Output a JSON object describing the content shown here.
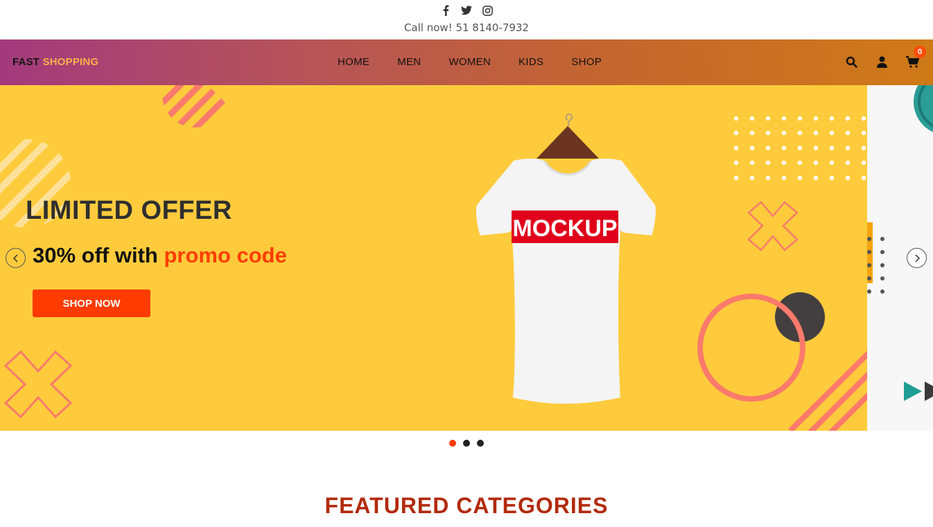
{
  "topbar": {
    "social": [
      {
        "name": "facebook-icon"
      },
      {
        "name": "twitter-icon"
      },
      {
        "name": "instagram-icon"
      }
    ],
    "phone_text": "Call now! 51 8140-7932"
  },
  "nav": {
    "logo_part1": "FAST",
    "logo_part2": "SHOPPING",
    "items": [
      {
        "label": "HOME"
      },
      {
        "label": "MEN"
      },
      {
        "label": "WOMEN"
      },
      {
        "label": "KIDS"
      },
      {
        "label": "SHOP"
      }
    ],
    "cart_count": "0",
    "icons": [
      "search-icon",
      "user-icon",
      "cart-icon"
    ]
  },
  "hero": {
    "title": "LIMITED OFFER",
    "subtitle_part1": "30% off with ",
    "subtitle_accent": "promo code",
    "button_label": "SHOP NOW",
    "mockup_text": "MOCKUP",
    "slide_count": 3,
    "active_slide": 1
  },
  "featured": {
    "title": "FEATURED CATEGORIES"
  },
  "colors": {
    "slide_bg": "#fecb3c",
    "accent": "#ff3b00",
    "nav_start": "#a33a7d",
    "nav_end": "#cf7a17",
    "featured_title": "#b22a0d"
  }
}
